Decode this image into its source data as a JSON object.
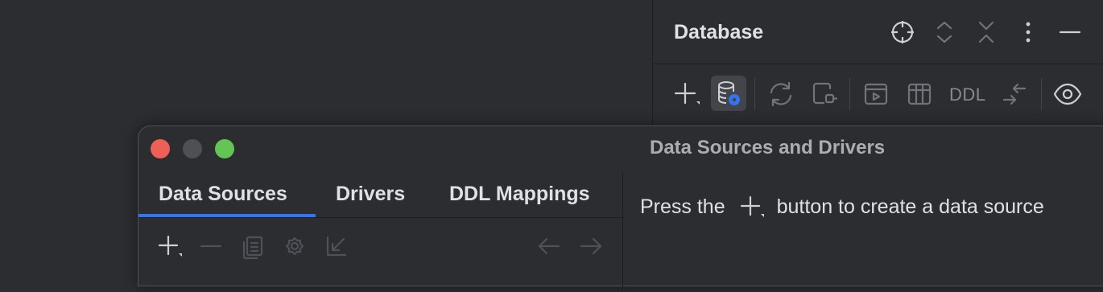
{
  "database_panel": {
    "title": "Database",
    "header_icons": [
      "crosshair-icon",
      "expand-all-icon",
      "collapse-all-icon",
      "more-vertical-icon",
      "minimize-icon"
    ],
    "toolbar": {
      "items": [
        "add-icon",
        "data-source-properties-icon",
        "refresh-icon",
        "disconnect-icon",
        "console-icon",
        "table-icon",
        "ddl",
        "jump-to-icon",
        "eye-icon"
      ],
      "ddl_label": "DDL"
    }
  },
  "dialog": {
    "title": "Data Sources and Drivers",
    "tabs": [
      {
        "label": "Data Sources",
        "active": true
      },
      {
        "label": "Drivers"
      },
      {
        "label": "DDL Mappings"
      }
    ],
    "toolbar_icons": [
      "add-icon",
      "remove-icon",
      "copy-icon",
      "settings-icon",
      "import-icon",
      "back-arrow-icon",
      "forward-arrow-icon"
    ],
    "empty_message": {
      "before": "Press the",
      "after": "button to create a data source"
    }
  },
  "colors": {
    "background": "#2b2d30",
    "accent": "#3574f0",
    "text": "#dfe1e5",
    "muted_icon": "#6f737a",
    "close": "#ee5f57",
    "zoom": "#62c554"
  }
}
